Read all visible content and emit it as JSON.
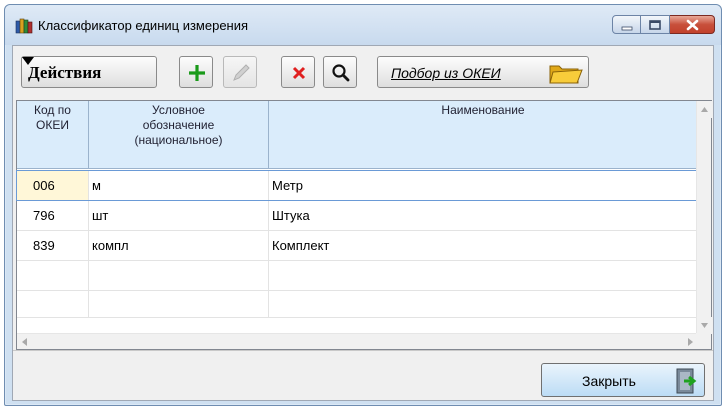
{
  "window": {
    "title": "Классификатор единиц измерения",
    "icon": "books-icon"
  },
  "toolbar": {
    "actions_label": "Действия",
    "okei_label": "Подбор из ОКЕИ",
    "icons": [
      "plus-icon",
      "pencil-icon",
      "cross-icon",
      "magnifier-icon",
      "folder-icon"
    ],
    "colors": {
      "add": "#1a9a1a",
      "delete": "#e02020"
    }
  },
  "grid": {
    "columns": [
      {
        "label": "Код по\nОКЕИ"
      },
      {
        "label": "Условное\nобозначение\n(национальное)"
      },
      {
        "label": "Наименование"
      }
    ],
    "rows": [
      {
        "code": "006",
        "symbol": "м",
        "name": "Метр",
        "selected": true
      },
      {
        "code": "796",
        "symbol": "шт",
        "name": "Штука",
        "selected": false
      },
      {
        "code": "839",
        "symbol": "компл",
        "name": "Комплект",
        "selected": false
      }
    ],
    "empty_rows": 2,
    "header_color": "#daecfb"
  },
  "footer": {
    "close_label": "Закрыть"
  }
}
